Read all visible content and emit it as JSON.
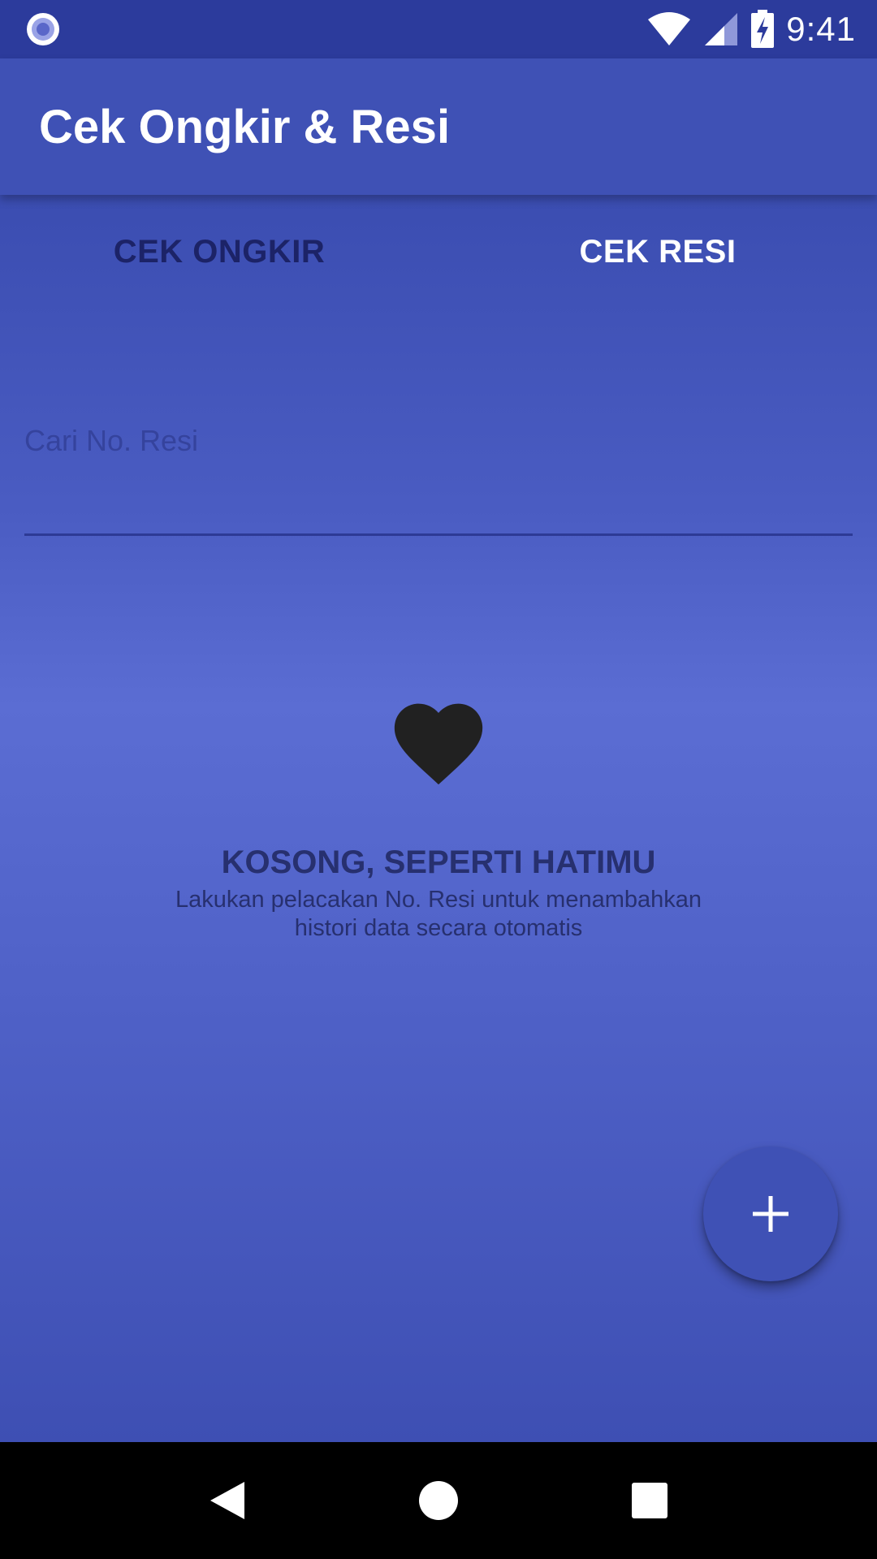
{
  "status_bar": {
    "time": "9:41",
    "icons": [
      "notification-dot-icon",
      "wifi-icon",
      "cell-signal-icon",
      "battery-charging-icon"
    ]
  },
  "app_bar": {
    "title": "Cek Ongkir & Resi"
  },
  "tabs": [
    {
      "label": "CEK ONGKIR",
      "selected": false
    },
    {
      "label": "CEK RESI",
      "selected": true
    }
  ],
  "search": {
    "placeholder": "Cari No. Resi",
    "value": ""
  },
  "empty_state": {
    "icon": "heart-icon",
    "title": "KOSONG, SEPERTI HATIMU",
    "description": "Lakukan pelacakan No. Resi untuk menambahkan histori data secara otomatis"
  },
  "fab": {
    "icon": "plus-icon"
  },
  "nav_bar": {
    "icons": [
      "back-icon",
      "home-icon",
      "recents-icon"
    ]
  },
  "colors": {
    "primary": "#3f51b5",
    "status_bar": "#2c3b9c",
    "tab_active_text": "#ffffff",
    "tab_inactive_text": "#1c2367",
    "empty_text": "#27306f"
  }
}
